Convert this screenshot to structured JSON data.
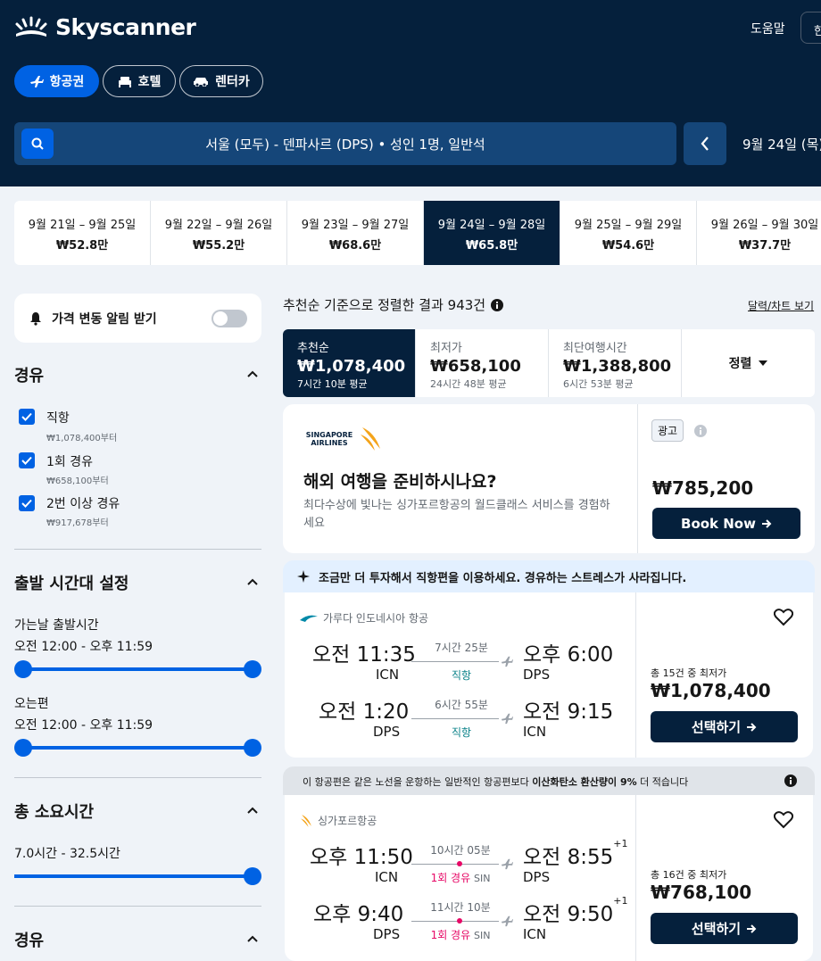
{
  "header": {
    "logo_text": "Skyscanner",
    "help": "도움말",
    "lang": "한",
    "tabs": [
      {
        "label": "항공권",
        "icon": "plane-icon"
      },
      {
        "label": "호텔",
        "icon": "bed-icon"
      },
      {
        "label": "렌터카",
        "icon": "car-icon"
      }
    ],
    "search_summary": "서울 (모두) - 덴파사르 (DPS)  •  성인 1명, 일반석",
    "date_summary": "9월 24일 (목)"
  },
  "date_strip": [
    {
      "range": "9월 21일 – 9월 25일",
      "price": "₩52.8만"
    },
    {
      "range": "9월 22일 – 9월 26일",
      "price": "₩55.2만"
    },
    {
      "range": "9월 23일 – 9월 27일",
      "price": "₩68.6만"
    },
    {
      "range": "9월 24일 – 9월 28일",
      "price": "₩65.8만"
    },
    {
      "range": "9월 25일 – 9월 29일",
      "price": "₩54.6만"
    },
    {
      "range": "9월 26일 – 9월 30일",
      "price": "₩37.7만"
    }
  ],
  "filters": {
    "price_alert": "가격 변동 알림 받기",
    "stops_title": "경유",
    "stops": [
      {
        "label": "직항",
        "sub": "₩1,078,400부터"
      },
      {
        "label": "1회 경유",
        "sub": "₩658,100부터"
      },
      {
        "label": "2번 이상 경유",
        "sub": "₩917,678부터"
      }
    ],
    "times_title": "출발 시간대 설정",
    "outbound_label": "가는날 출발시간",
    "outbound_range": "오전 12:00 - 오후 11:59",
    "return_label": "오는편",
    "return_range": "오전 12:00 - 오후 11:59",
    "duration_title": "총 소요시간",
    "duration_range": "7.0시간 - 32.5시간",
    "layover_title": "경유"
  },
  "results": {
    "summary": "추천순 기준으로 정렬한 결과 943건",
    "chart_link": "달력/차트 보기",
    "sort_tabs": [
      {
        "label": "추천순",
        "price": "₩1,078,400",
        "detail": "7시간 10분 평균"
      },
      {
        "label": "최저가",
        "price": "₩658,100",
        "detail": "24시간 48분 평균"
      },
      {
        "label": "최단여행시간",
        "price": "₩1,388,800",
        "detail": "6시간 53분 평균"
      }
    ],
    "sort_label": "정렬"
  },
  "ad": {
    "brand": "SINGAPORE AIRLINES",
    "title": "해외 여행을 준비하시나요?",
    "body": "최다수상에 빛나는 싱가포르항공의 월드클래스 서비스를 경험하세요",
    "tag": "광고",
    "price": "₩785,200",
    "button": "Book Now"
  },
  "banner": "조금만 더 투자해서 직항편을 이용하세요. 경유하는 스트레스가 사라집니다.",
  "flight1": {
    "airline": "가루다 인도네시아 항공",
    "legs": [
      {
        "dep_time": "오전 11:35",
        "dep": "ICN",
        "dur": "7시간 25분",
        "stops": "직항",
        "arr_time": "오후 6:00",
        "arr": "DPS"
      },
      {
        "dep_time": "오전 1:20",
        "dep": "DPS",
        "dur": "6시간 55분",
        "stops": "직항",
        "arr_time": "오전 9:15",
        "arr": "ICN"
      }
    ],
    "deals": "총 15건 중 최저가",
    "price": "₩1,078,400",
    "button": "선택하기"
  },
  "co2": {
    "prefix": "이 항공편은 같은 노선을 운항하는 일반적인 항공편보다 ",
    "bold": "이산화탄소 환산량이 9%",
    "suffix": " 더 적습니다"
  },
  "flight2": {
    "airline": "싱가포르항공",
    "legs": [
      {
        "dep_time": "오후 11:50",
        "dep": "ICN",
        "dur": "10시간 05분",
        "stops": "1회 경유",
        "via": "SIN",
        "arr_time": "오전 8:55",
        "plus": "+1",
        "arr": "DPS"
      },
      {
        "dep_time": "오후 9:40",
        "dep": "DPS",
        "dur": "11시간 10분",
        "stops": "1회 경유",
        "via": "SIN",
        "arr_time": "오전 9:50",
        "plus": "+1",
        "arr": "ICN"
      }
    ],
    "deals": "총 16건 중 최저가",
    "price": "₩768,100",
    "button": "선택하기"
  },
  "colors": {
    "navy": "#05203c",
    "blue": "#0062e3",
    "pink": "#e70866",
    "green": "#0c838a"
  }
}
